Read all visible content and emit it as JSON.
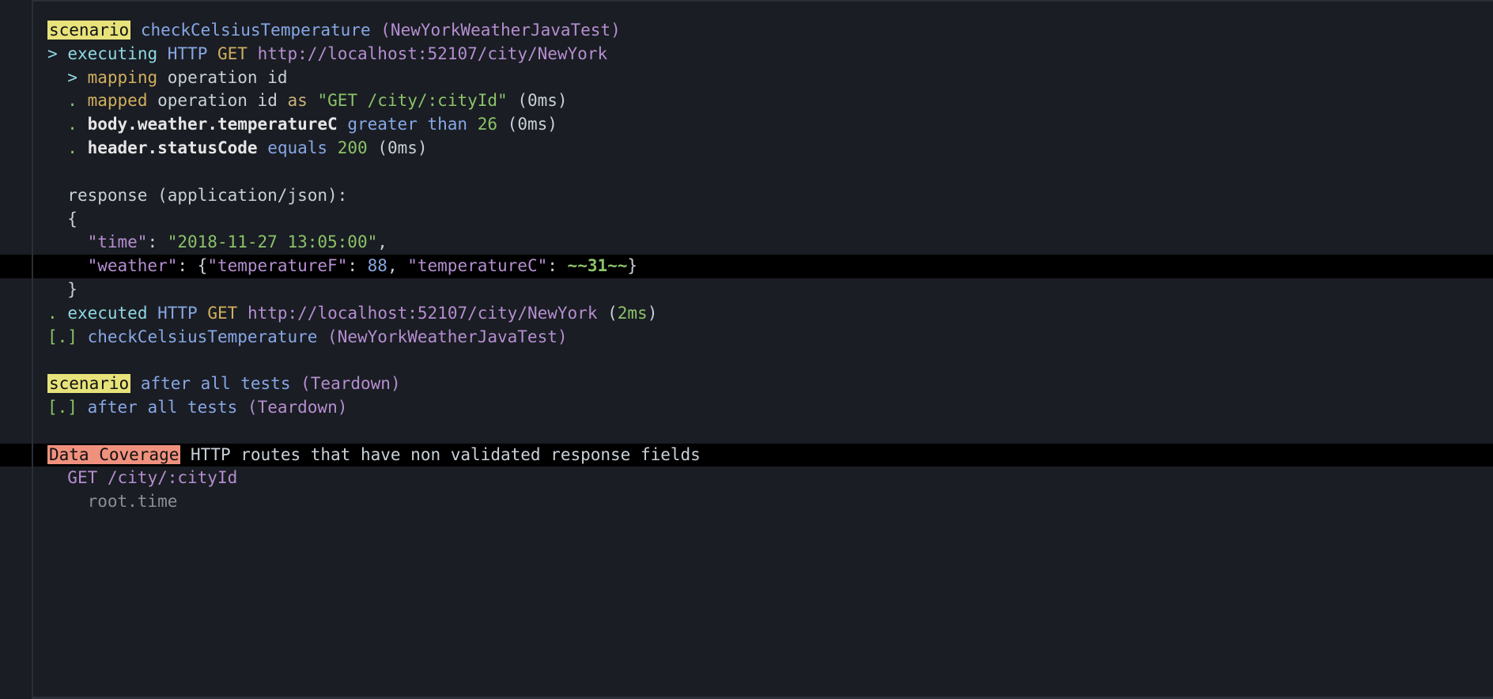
{
  "scenario1": {
    "label": "scenario",
    "name": "checkCelsiusTemperature",
    "suite": "NewYorkWeatherJavaTest"
  },
  "exec": {
    "prefix": ">",
    "word": "executing",
    "http": "HTTP",
    "method": "GET",
    "url": "http://localhost:52107/city/NewYork"
  },
  "mapping": {
    "prefix": ">",
    "word": "mapping",
    "rest": "operation id"
  },
  "mapped": {
    "prefix": ".",
    "word": "mapped",
    "mid": "operation id",
    "as": "as",
    "value": "\"GET /city/:cityId\"",
    "time": "(0ms)"
  },
  "assert1": {
    "prefix": ".",
    "path": "body.weather.temperatureC",
    "op": "greater than",
    "val": "26",
    "time": "(0ms)"
  },
  "assert2": {
    "prefix": ".",
    "path": "header.statusCode",
    "op": "equals",
    "val": "200",
    "time": "(0ms)"
  },
  "response_header": "response (application/json):",
  "json": {
    "open": "{",
    "time_key": "\"time\"",
    "time_val": "\"2018-11-27 13:05:00\"",
    "weather_key": "\"weather\"",
    "weather_open": "{",
    "tempF_key": "\"temperatureF\"",
    "tempF_val": "88",
    "tempC_key": "\"temperatureC\"",
    "tempC_val": "~~31~~",
    "weather_close": "}",
    "close": "}"
  },
  "executed": {
    "prefix": ".",
    "word": "executed",
    "http": "HTTP",
    "method": "GET",
    "url": "http://localhost:52107/city/NewYork",
    "time": "(2ms)"
  },
  "result1": {
    "prefix": "[.]",
    "name": "checkCelsiusTemperature",
    "suite": "NewYorkWeatherJavaTest"
  },
  "scenario2": {
    "label": "scenario",
    "name": "after all tests",
    "suite": "Teardown"
  },
  "result2": {
    "prefix": "[.]",
    "name": "after all tests",
    "suite": "Teardown"
  },
  "coverage": {
    "label": "Data Coverage",
    "desc": "HTTP routes that have non validated response fields",
    "route": "GET /city/:cityId",
    "field": "root.time"
  }
}
